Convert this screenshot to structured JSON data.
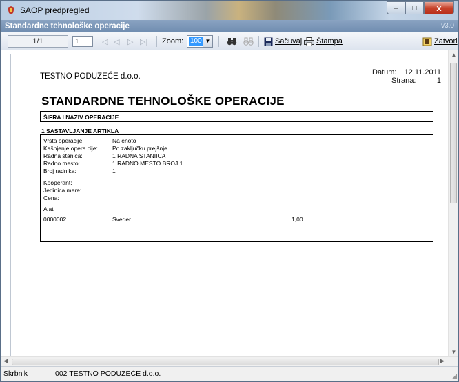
{
  "window": {
    "title": "SAOP predpregled",
    "controls": [
      "–",
      "□",
      "x"
    ]
  },
  "report_header": {
    "title": "Standardne tehnološke operacije",
    "version": "v3.0"
  },
  "toolbar": {
    "page_display": "1/1",
    "page_input": "1",
    "zoom_label": "Zoom:",
    "zoom_value": "100",
    "save_label": "Sačuvaj",
    "print_label": "Štampa",
    "close_label": "Zatvori"
  },
  "document": {
    "company": "TESTNO PODUZEĆE d.o.o.",
    "date_label": "Datum:",
    "date_value": "12.11.2011",
    "page_label": "Strana:",
    "page_value": "1",
    "heading": "STANDARDNE TEHNOLOŠKE OPERACIJE",
    "code_header": "ŠIFRA I NAZIV OPERACIJE",
    "section_title": "1 SASTAVLJANJE ARTIKLA",
    "operation_fields": [
      {
        "label": "Vrsta operacije:",
        "value": "Na enoto"
      },
      {
        "label": "Kašnjenje opera cije:",
        "value": "Po zaključku prejšnje"
      },
      {
        "label": "Radna stanica:",
        "value": "1 RADNA STANIICA"
      },
      {
        "label": "Radno mesto:",
        "value": "1 RADNO MESTO BROJ 1"
      },
      {
        "label": "Broj radnika:",
        "value": "1"
      }
    ],
    "coop_fields": [
      {
        "label": "Kooperant:"
      },
      {
        "label": "Jedinica mere:"
      },
      {
        "label": "Cena:"
      }
    ],
    "tools_label": "Alati",
    "tools": [
      {
        "code": "0000002",
        "name": "Sveder",
        "qty": "1,00"
      }
    ]
  },
  "statusbar": {
    "left": "Skrbnik",
    "right": "002  TESTNO PODUZEĆE d.o.o."
  }
}
